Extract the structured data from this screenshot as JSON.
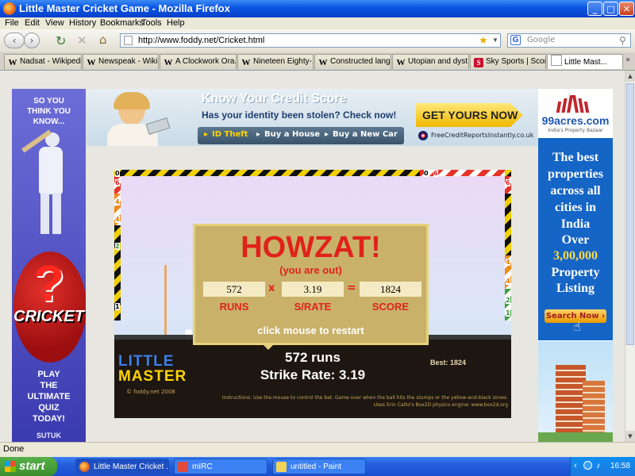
{
  "window": {
    "title": "Little Master Cricket Game - Mozilla Firefox",
    "buttons": {
      "minimize": "_",
      "maximize": "□",
      "close": "✕"
    }
  },
  "menu": [
    "File",
    "Edit",
    "View",
    "History",
    "Bookmarks",
    "Tools",
    "Help"
  ],
  "nav": {
    "url": "http://www.foddy.net/Cricket.html",
    "search_placeholder": "Google"
  },
  "tabs": [
    {
      "label": "Nadsat - Wikipedi...",
      "icon": "W"
    },
    {
      "label": "Newspeak - Wikip...",
      "icon": "W"
    },
    {
      "label": "A Clockwork Ora...",
      "icon": "W"
    },
    {
      "label": "Nineteen Eighty-...",
      "icon": "W"
    },
    {
      "label": "Constructed lang...",
      "icon": "W"
    },
    {
      "label": "Utopian and dyst...",
      "icon": "W"
    },
    {
      "label": "Sky Sports | Scor...",
      "icon": "S"
    },
    {
      "label": "Little Mast...",
      "icon": "page",
      "active": true
    }
  ],
  "left_ad": {
    "line1": "SO YOU",
    "line2": "THINK YOU",
    "line3": "KNOW...",
    "qmark": "?",
    "brand": "CRICKET",
    "cta1": "PLAY",
    "cta2": "THE",
    "cta3": "ULTIMATE",
    "cta4": "QUIZ",
    "cta5": "TODAY!",
    "footer": "SUTUK"
  },
  "top_ad": {
    "headline": "Know Your Credit Score",
    "subline": "Has your identity been stolen?  Check now!",
    "link1": "ID Theft",
    "link2": "Buy a House",
    "link3": "Buy a New Car",
    "cta": "GET YOURS NOW",
    "site": "FreeCreditReportsInstantly.co.uk"
  },
  "right_ad": {
    "brand": "99acres.com",
    "tagline": "India's Property Bazaar",
    "body": "The best properties across all cities in India",
    "over": "Over",
    "count": "3,00,000",
    "listing": "Property Listing",
    "button": "Search Now ›"
  },
  "game": {
    "dialog_title": "HOWZAT!",
    "dialog_sub": "(you are out)",
    "runs_value": "572",
    "times": "x",
    "srate_value": "3.19",
    "equals": "=",
    "score_value": "1824",
    "runs_label": "RUNS",
    "srate_label": "S/RATE",
    "score_label": "SCORE",
    "restart": "click mouse to restart",
    "runs_display": "572 runs",
    "strike_display": "Strike Rate: 3.19",
    "best": "Best: 1824",
    "logo_top": "LITTLE",
    "logo_bottom": "MASTER",
    "copyright": "© foddy.net 2008",
    "instructions": "Instructions: Use the mouse to control the bat. Game over when the ball hits the stumps or the yellow-and-black zones.",
    "credit": "Uses Erin Catto's Box2D physics engine: www.box2d.org",
    "zone_top_left": "0",
    "zone_top_right_a": "0",
    "zone_top_right_b": "6",
    "left_zones": [
      "6",
      "4",
      "4",
      "2",
      "1"
    ],
    "right_zones": [
      "6",
      "4",
      "4",
      "2",
      "1"
    ]
  },
  "status": "Done",
  "taskbar": {
    "start": "start",
    "tasks": [
      {
        "label": "Little Master Cricket ..."
      },
      {
        "label": "mIRC"
      },
      {
        "label": "untitled - Paint"
      }
    ],
    "clock": "16:58"
  }
}
